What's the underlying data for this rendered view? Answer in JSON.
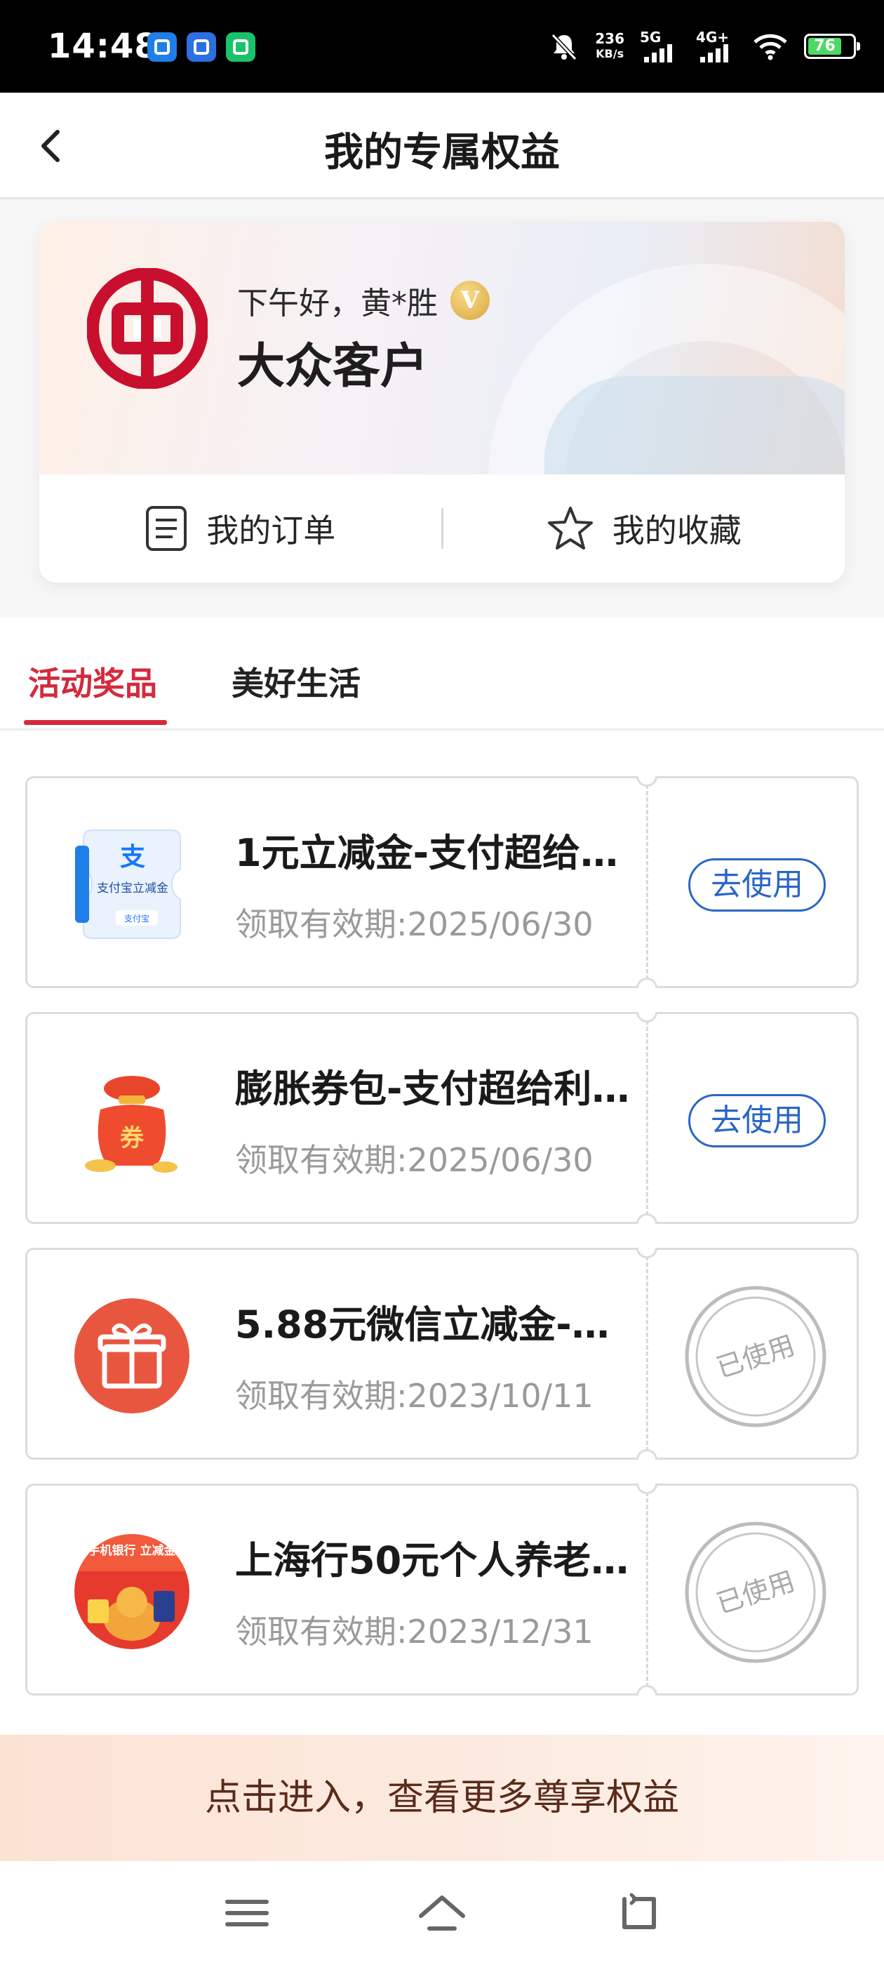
{
  "status_bar": {
    "time": "14:48",
    "net_speed_value": "236",
    "net_speed_unit": "KB/s",
    "sim1": "5G",
    "sim2": "4G+",
    "battery": "76"
  },
  "header": {
    "title": "我的专属权益"
  },
  "member": {
    "greeting": "下午好，黄*胜",
    "vip_badge": "V",
    "level": "大众客户",
    "orders_label": "我的订单",
    "favorites_label": "我的收藏"
  },
  "tabs": [
    {
      "label": "活动奖品",
      "active": true
    },
    {
      "label": "美好生活",
      "active": false
    }
  ],
  "coupons": [
    {
      "icon_text": "支付宝立减金",
      "icon_small": "支付宝",
      "title": "1元立减金-支付超给…",
      "date": "领取有效期:2025/06/30",
      "action": "去使用",
      "status": "available"
    },
    {
      "icon_text": "券",
      "title": "膨胀券包-支付超给利…",
      "date": "领取有效期:2025/06/30",
      "action": "去使用",
      "status": "available"
    },
    {
      "title": "5.88元微信立减金-…",
      "date": "领取有效期:2023/10/11",
      "stamp": "已使用",
      "status": "used"
    },
    {
      "icon_text": "银行手机银行 立减金领取",
      "title": "上海行50元个人养老…",
      "date": "领取有效期:2023/12/31",
      "stamp": "已使用",
      "status": "used"
    }
  ],
  "banner": {
    "text": "点击进入，查看更多尊享权益"
  },
  "colors": {
    "accent_red": "#d42a3d",
    "use_blue": "#2a66c4",
    "stamp_grey": "#b8b8b8"
  }
}
